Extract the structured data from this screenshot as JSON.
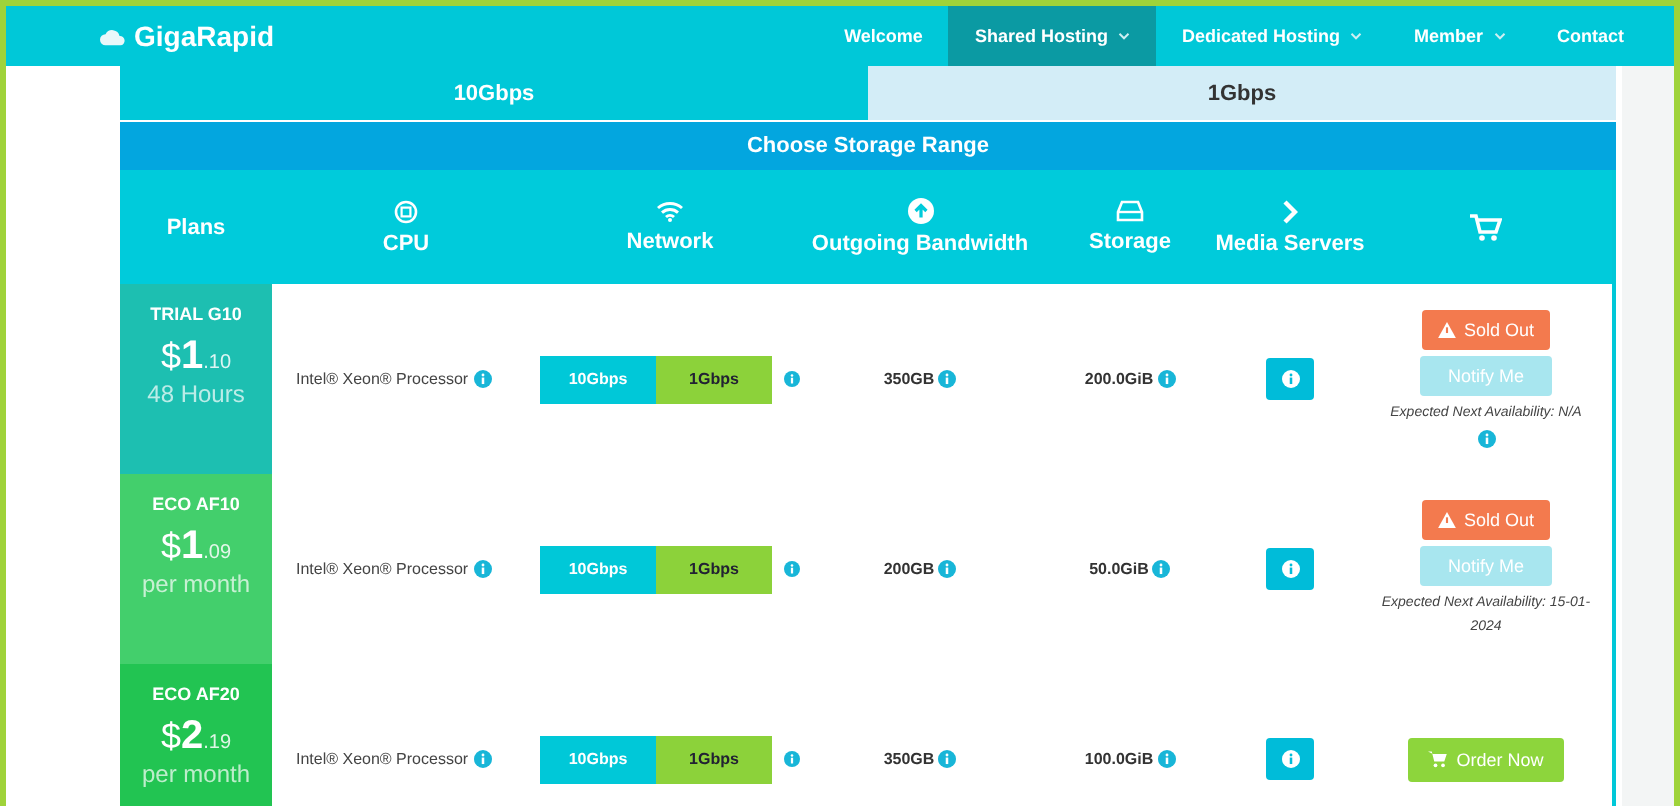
{
  "navbar": {
    "logo": "GigaRapid",
    "items": [
      {
        "label": "Welcome",
        "selected": false,
        "dropdown": false
      },
      {
        "label": "Shared Hosting",
        "selected": true,
        "dropdown": true
      },
      {
        "label": "Dedicated Hosting",
        "selected": false,
        "dropdown": true
      },
      {
        "label": "Member",
        "selected": false,
        "dropdown": true
      },
      {
        "label": "Contact",
        "selected": false,
        "dropdown": false
      }
    ]
  },
  "tabs": [
    {
      "label": "10Gbps",
      "selected": true
    },
    {
      "label": "1Gbps",
      "selected": false
    }
  ],
  "range_bar": "Choose Storage Range",
  "columns": [
    "Plans",
    "CPU",
    "Network",
    "Outgoing Bandwidth",
    "Storage",
    "Media Servers"
  ],
  "plans": [
    {
      "name": "TRIAL G10",
      "color": "#1dbfb1",
      "currency": "$",
      "amount": "1",
      "cents": ".10",
      "period": "48 Hours",
      "cpu": "Intel® Xeon® Processor",
      "network": [
        {
          "label": "10Gbps",
          "selected": false
        },
        {
          "label": "1Gbps",
          "selected": true
        }
      ],
      "bandwidth": "350GB",
      "storage": "200.0GiB",
      "action": {
        "kind": "sold_out",
        "label": "Sold Out",
        "notify": "Notify Me",
        "notify_disabled": true,
        "availability": "Expected Next Availability: N/A",
        "availability_info": true
      }
    },
    {
      "name": "ECO AF10",
      "color": "#43cf6c",
      "currency": "$",
      "amount": "1",
      "cents": ".09",
      "period": "per month",
      "cpu": "Intel® Xeon® Processor",
      "network": [
        {
          "label": "10Gbps",
          "selected": false
        },
        {
          "label": "1Gbps",
          "selected": true
        }
      ],
      "bandwidth": "200GB",
      "storage": "50.0GiB",
      "action": {
        "kind": "sold_out",
        "label": "Sold Out",
        "notify": "Notify Me",
        "notify_disabled": true,
        "availability": "Expected Next Availability: 15-01-2024",
        "availability_info": false
      }
    },
    {
      "name": "ECO AF20",
      "color": "#22c452",
      "currency": "$",
      "amount": "2",
      "cents": ".19",
      "period": "per month",
      "cpu": "Intel® Xeon® Processor",
      "network": [
        {
          "label": "10Gbps",
          "selected": false
        },
        {
          "label": "1Gbps",
          "selected": true
        }
      ],
      "bandwidth": "350GB",
      "storage": "100.0GiB",
      "action": {
        "kind": "order",
        "label": "Order Now"
      }
    }
  ]
}
